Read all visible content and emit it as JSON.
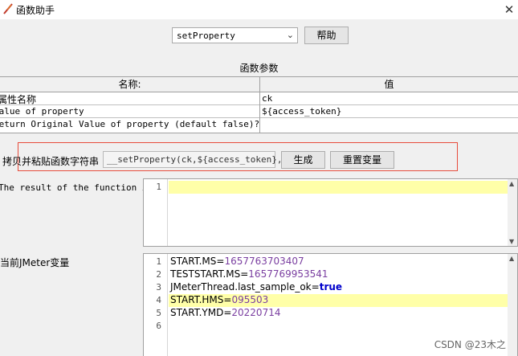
{
  "window": {
    "title": "函数助手",
    "close_glyph": "✕"
  },
  "function_select": {
    "value": "setProperty",
    "arrow": "⌄"
  },
  "help_button": "帮助",
  "params": {
    "heading": "函数参数",
    "col_name": "名称:",
    "col_value": "值",
    "rows": [
      {
        "name": "属性名称",
        "value": "ck"
      },
      {
        "name": "Value of property",
        "value": "${access_token}"
      },
      {
        "name": "Return Original Value of property (default false)?",
        "value": ""
      }
    ]
  },
  "copy": {
    "label": "拷贝并粘贴函数字符串",
    "value": "__setProperty(ck,${access_token},)}",
    "generate": "生成",
    "reset": "重置变量"
  },
  "result": {
    "label": "The result of the function is",
    "lines": [
      "1"
    ]
  },
  "vars": {
    "label": "当前JMeter变量",
    "line_numbers": [
      "1",
      "2",
      "3",
      "4",
      "5",
      "6"
    ],
    "lines": [
      {
        "key": "START.MS=",
        "value": "1657763703407"
      },
      {
        "key": "TESTSTART.MS=",
        "value": "1657769953541"
      },
      {
        "key": "JMeterThread.last_sample_ok=",
        "value": "true"
      },
      {
        "key": "START.HMS=",
        "value": "095503"
      },
      {
        "key": "START.YMD=",
        "value": "20220714"
      }
    ]
  },
  "watermark": "CSDN @23木之",
  "colors": {
    "highlight": "#ffffa8",
    "border_red": "#e74c3c",
    "number": "#7a3ea0",
    "keyword": "#0000cc"
  }
}
